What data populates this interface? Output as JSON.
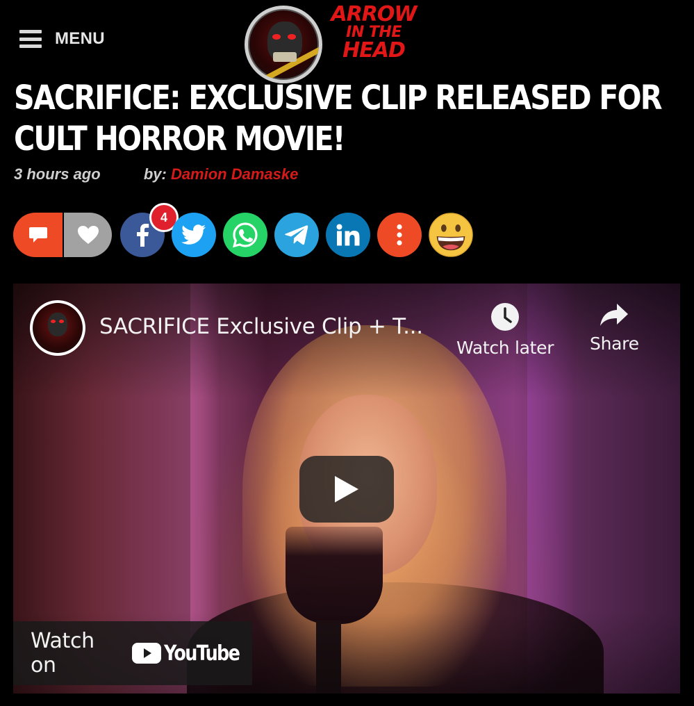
{
  "header": {
    "menu_label": "MENU",
    "logo": {
      "line1": "ARROW",
      "line2": "IN THE",
      "line3": "HEAD"
    }
  },
  "article": {
    "title": "SACRIFICE: EXCLUSIVE CLIP RELEASED FOR CULT HORROR MOVIE!",
    "time": "3 hours ago",
    "by_label": "by:",
    "author": "Damion Damaske"
  },
  "share": {
    "buttons": [
      {
        "name": "comment",
        "icon": "comment-icon",
        "color": "#ee4a25"
      },
      {
        "name": "like",
        "icon": "heart-icon",
        "color": "#a2a2a2"
      },
      {
        "name": "facebook",
        "icon": "facebook-icon",
        "color": "#3b5998"
      },
      {
        "name": "twitter",
        "icon": "twitter-icon",
        "color": "#1da1f2"
      },
      {
        "name": "whatsapp",
        "icon": "whatsapp-icon",
        "color": "#25d366"
      },
      {
        "name": "telegram",
        "icon": "telegram-icon",
        "color": "#2aa3df"
      },
      {
        "name": "linkedin",
        "icon": "linkedin-icon",
        "color": "#0a77b5"
      },
      {
        "name": "more",
        "icon": "more-icon",
        "color": "#ee4a25"
      },
      {
        "name": "reaction",
        "icon": "grinning-face-icon",
        "color": "#f5c542"
      }
    ],
    "facebook_count": "4"
  },
  "video": {
    "title": "SACRIFICE Exclusive Clip + T...",
    "watch_later_label": "Watch later",
    "share_label": "Share",
    "watch_on_label": "Watch on",
    "youtube_wordmark": "YouTube"
  }
}
